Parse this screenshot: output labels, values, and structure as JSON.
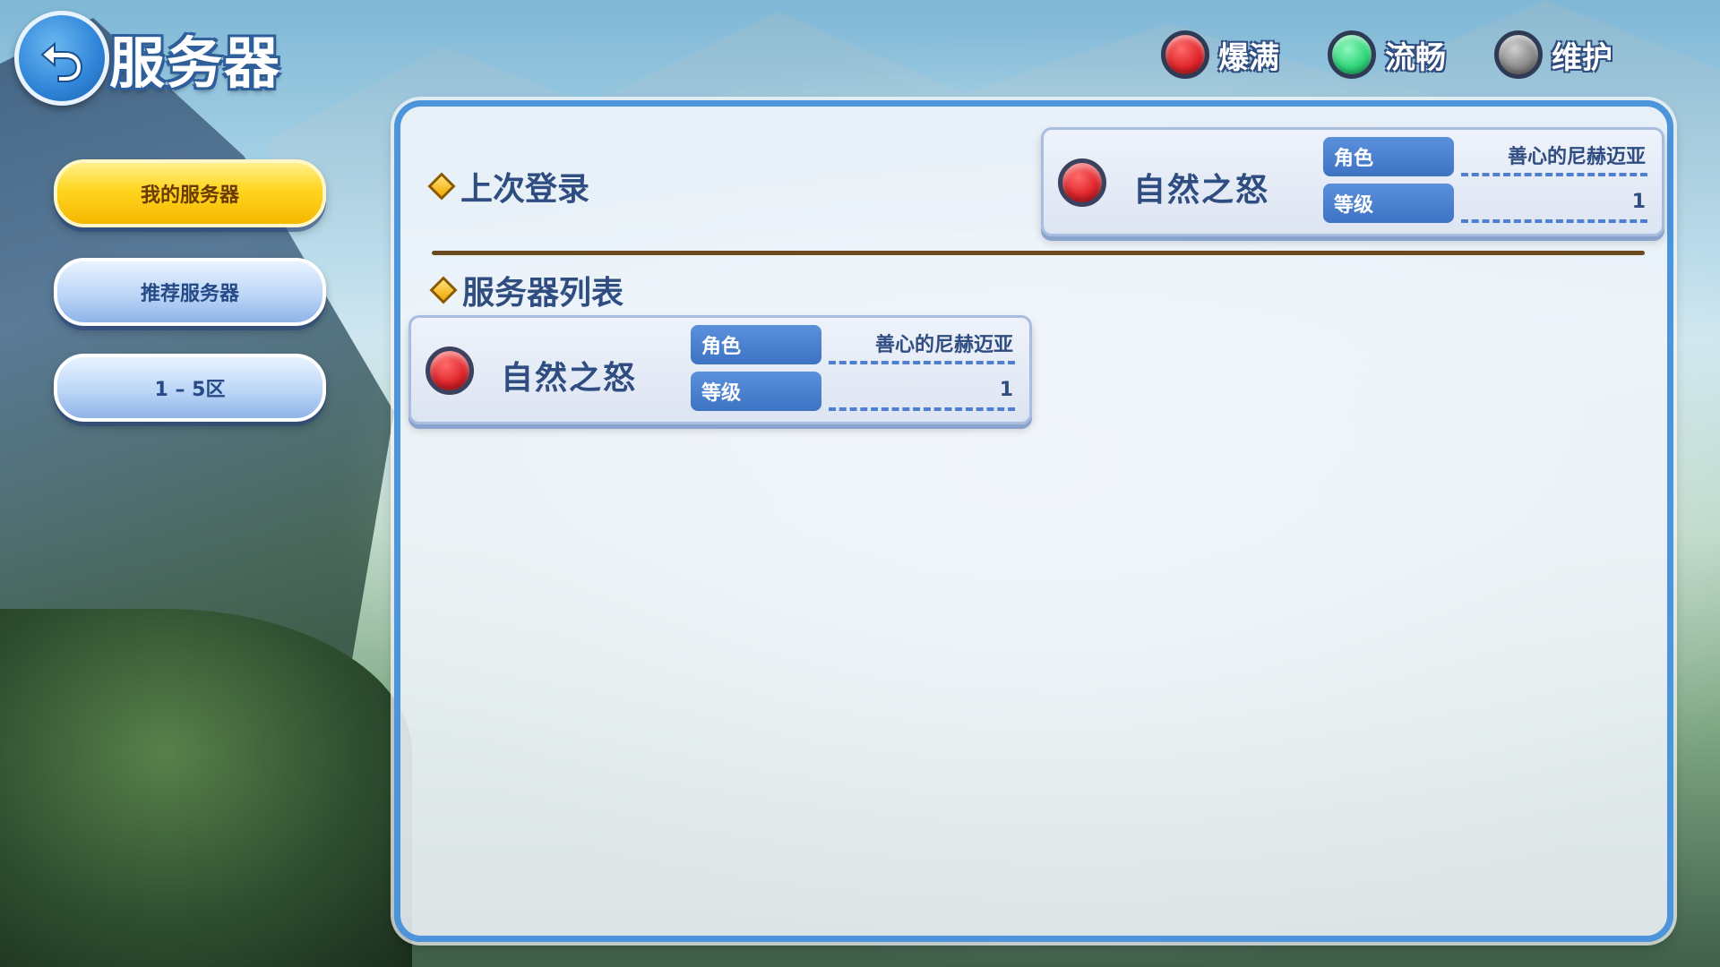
{
  "header": {
    "title": "服务器",
    "back_icon": "back-arrow-icon"
  },
  "legend": [
    {
      "label": "爆满",
      "color": "#e0262c"
    },
    {
      "label": "流畅",
      "color": "#2fd67a"
    },
    {
      "label": "维护",
      "color": "#8a8a8a"
    }
  ],
  "sidebar": {
    "items": [
      {
        "label": "我的服务器",
        "active": true
      },
      {
        "label": "推荐服务器",
        "active": false
      },
      {
        "label": "1 – 5区",
        "active": false
      }
    ]
  },
  "last_login": {
    "section_title": "上次登录",
    "server": {
      "name": "自然之怒",
      "status_color": "#e0262c",
      "role_label": "角色",
      "role_value": "善心的尼赫迈亚",
      "level_label": "等级",
      "level_value": "1"
    }
  },
  "server_list": {
    "section_title": "服务器列表",
    "servers": [
      {
        "name": "自然之怒",
        "status_color": "#e0262c",
        "role_label": "角色",
        "role_value": "善心的尼赫迈亚",
        "level_label": "等级",
        "level_value": "1"
      }
    ]
  }
}
